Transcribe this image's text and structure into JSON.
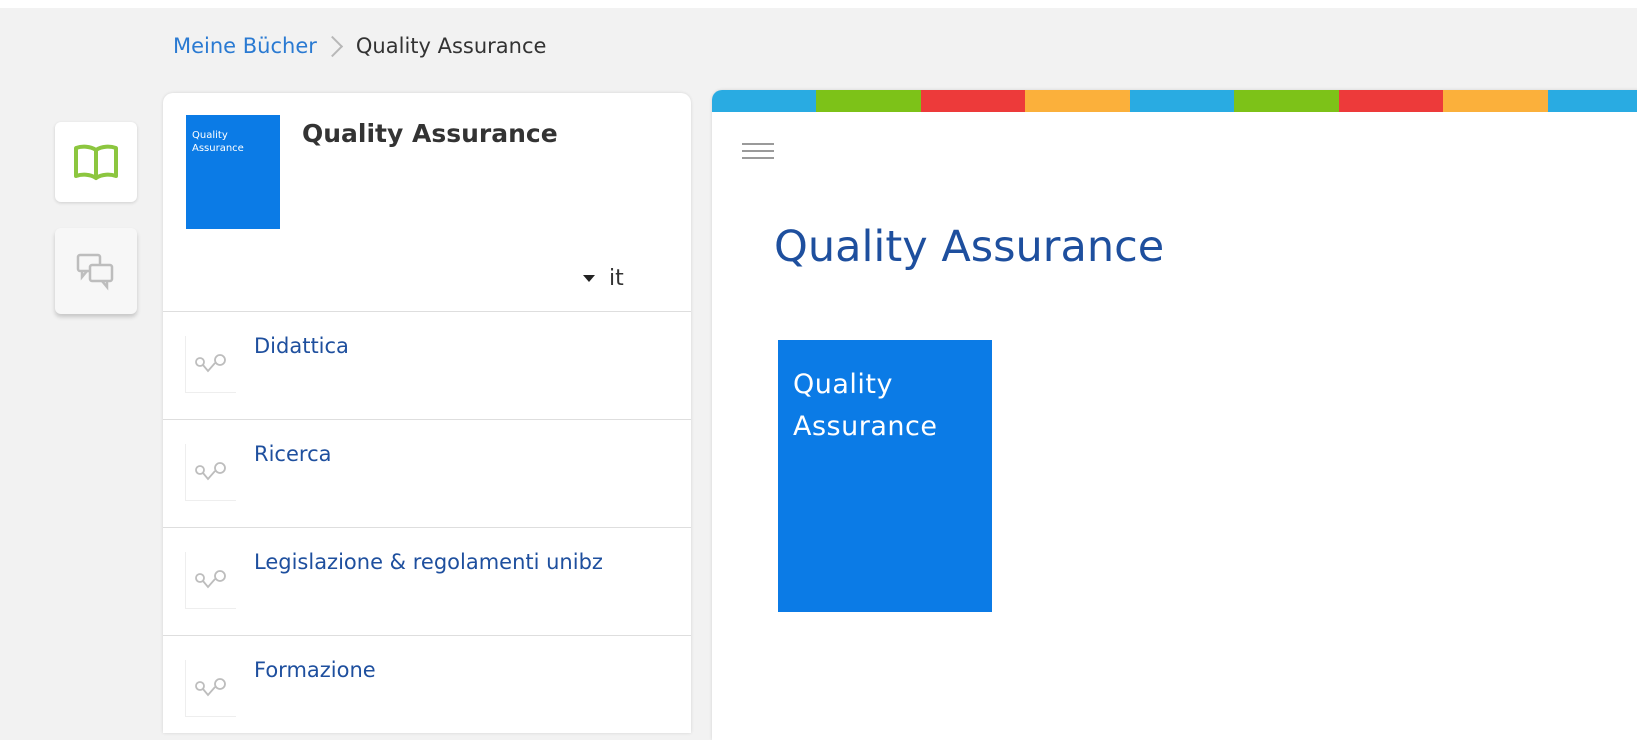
{
  "breadcrumb": {
    "root": "Meine Bücher",
    "current": "Quality Assurance"
  },
  "rail": {
    "items": [
      {
        "icon": "open-book-icon",
        "active": true,
        "color": "#8cc63f"
      },
      {
        "icon": "chat-bubbles-icon",
        "active": false,
        "color": "#bdbdbd"
      }
    ]
  },
  "book": {
    "title": "Quality Assurance",
    "cover_line1": "Quality",
    "cover_line2": "Assurance",
    "cover_color": "#0b7be6",
    "language": "it"
  },
  "chapters": [
    {
      "label": "Didattica",
      "icon": "link-nodes-icon"
    },
    {
      "label": "Ricerca",
      "icon": "link-nodes-icon"
    },
    {
      "label": "Legislazione & regolamenti unibz",
      "icon": "link-nodes-icon"
    },
    {
      "label": "Formazione",
      "icon": "link-nodes-icon"
    }
  ],
  "content": {
    "title": "Quality Assurance",
    "cover_line1": "Quality",
    "cover_line2": "Assurance",
    "stripe_colors": [
      "#29abe2",
      "#7dc218",
      "#ed3a3a",
      "#fbb03b",
      "#29abe2",
      "#7dc218",
      "#ed3a3a",
      "#fbb03b",
      "#29abe2"
    ]
  }
}
